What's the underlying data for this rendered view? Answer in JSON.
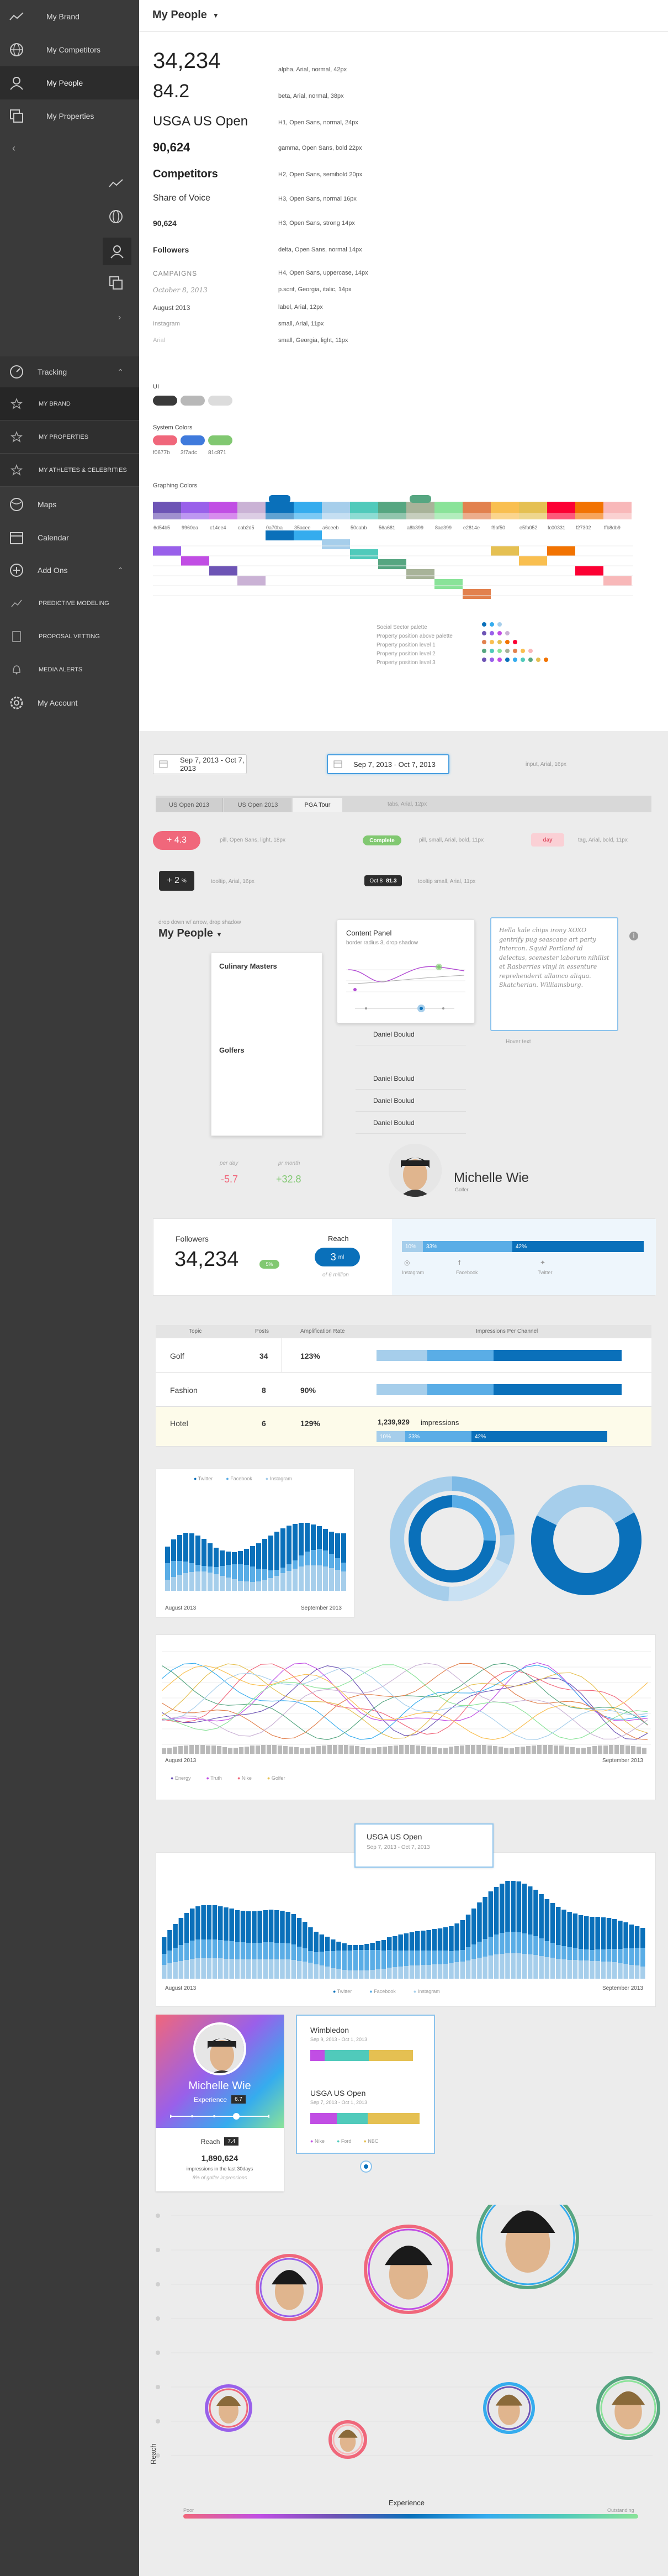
{
  "sidebar": {
    "top_items": [
      {
        "label": "My Brand",
        "icon": "trend-line-icon"
      },
      {
        "label": "My Competitors",
        "icon": "globe-icon"
      },
      {
        "label": "My People",
        "icon": "person-icon"
      },
      {
        "label": "My Properties",
        "icon": "layers-icon"
      }
    ],
    "sections": [
      {
        "label": "Tracking",
        "icon": "gauge-icon"
      },
      {
        "label": "Maps",
        "icon": "map-icon"
      },
      {
        "label": "Calendar",
        "icon": "calendar-icon"
      },
      {
        "label": "Add Ons",
        "icon": "plus-circle-icon"
      }
    ],
    "tracking_items": [
      "MY BRAND",
      "MY PROPERTIES",
      "MY ATHLETES & CELEBRITIES"
    ],
    "addon_items": [
      "PREDICTIVE MODELING",
      "PROPOSAL VETTING",
      "MEDIA ALERTS"
    ],
    "account_label": "My Account"
  },
  "header": {
    "title": "My People"
  },
  "typography": [
    {
      "sample": "34,234",
      "spec": "alpha, Arial, normal, 42px"
    },
    {
      "sample": "84.2",
      "spec": "beta, Arial, normal, 38px"
    },
    {
      "sample": "USGA US Open",
      "spec": "H1, Open Sans, normal, 24px"
    },
    {
      "sample": "90,624",
      "spec": "gamma, Open Sans, bold 22px"
    },
    {
      "sample": "Competitors",
      "spec": "H2, Open Sans, semibold 20px"
    },
    {
      "sample": "Share of Voice",
      "spec": "H3, Open Sans, normal 16px"
    },
    {
      "sample": "90,624",
      "spec": "H3, Open Sans, strong 14px"
    },
    {
      "sample": "Followers",
      "spec": "delta, Open Sans, normal 14px"
    },
    {
      "sample": "CAMPAIGNS",
      "spec": "H4, Open Sans, uppercase, 14px"
    },
    {
      "sample": "October 8, 2013",
      "spec": "p.scrif, Georgia, italic, 14px"
    },
    {
      "sample": "August 2013",
      "spec": "label, Arial, 12px"
    },
    {
      "sample": "Instagram",
      "spec": "small, Arial, 11px"
    },
    {
      "sample": "Arial",
      "spec": "small, Georgia, light, 11px"
    }
  ],
  "ui_label": "UI",
  "ui_colors": [
    "#3a3a3a",
    "#b8b8b8",
    "#dcdcdc"
  ],
  "system_colors_label": "System Colors",
  "system_colors": [
    {
      "hex": "f0677b",
      "color": "#f0677b"
    },
    {
      "hex": "3f7adc",
      "color": "#3f7adc"
    },
    {
      "hex": "81c871",
      "color": "#81c871"
    }
  ],
  "graphing_colors_label": "Graphing Colors",
  "graphing_colors": [
    {
      "hex": "6d54b5",
      "color": "#6d54b5"
    },
    {
      "hex": "9960ea",
      "color": "#9960ea"
    },
    {
      "hex": "c14ee4",
      "color": "#c14ee4"
    },
    {
      "hex": "cab2d5",
      "color": "#cab2d5"
    },
    {
      "hex": "0a70ba",
      "color": "#0a70ba"
    },
    {
      "hex": "35acee",
      "color": "#35acee"
    },
    {
      "hex": "a6ceeb",
      "color": "#a6ceeb"
    },
    {
      "hex": "50cabb",
      "color": "#50cabb"
    },
    {
      "hex": "56a681",
      "color": "#56a681"
    },
    {
      "hex": "a8b399",
      "color": "#a8b399"
    },
    {
      "hex": "8ae399",
      "color": "#8ae399"
    },
    {
      "hex": "e2814e",
      "color": "#e2814e"
    },
    {
      "hex": "f9bf50",
      "color": "#f9bf50"
    },
    {
      "hex": "e5fb052",
      "color": "#e5c052"
    },
    {
      "hex": "fc00331",
      "color": "#fc0033"
    },
    {
      "hex": "f27302",
      "color": "#f27302"
    },
    {
      "hex": "ffb8db9",
      "color": "#f8b8b9"
    }
  ],
  "scale_notes": [
    "Social Sector palette",
    "Property position above palette",
    "Property position level 1",
    "Property position level 2",
    "Property position level 3"
  ],
  "components": {
    "date1": "Sep 7, 2013 - Oct 7, 2013",
    "date2": "Sep 7, 2013 - Oct 7, 2013",
    "date_note": "input, Arial, 16px",
    "tabs": [
      "US Open 2013",
      "US Open 2013",
      "PGA Tour"
    ],
    "tabs_note": "tabs, Arial, 12px",
    "pill_red": "+ 4.3",
    "pill_red_note": "pill, Open Sans, light, 18px",
    "complete": "Complete",
    "complete_note": "pill, small, Arial, bold, 11px",
    "tag": "day",
    "tag_note": "tag, Arial, bold, 11px",
    "tooltip": "+ 2",
    "tooltip_unit": "%",
    "tooltip_note": "tooltip, Arial, 16px",
    "tooltip2": "Oct 8",
    "tooltip2_val": "81.3",
    "tooltip2_note": "tooltip small, Arial, 11px",
    "dropdown_note": "drop down w/ arrow, drop shadow",
    "dropdown_title": "My People",
    "list_header1": "Culinary Masters",
    "list_header2": "Golfers",
    "list_items": [
      "Daniel Boulud",
      "Daniel Boulud",
      "Daniel Boulud",
      "Daniel Boulud",
      "Daniel Boulud",
      "Daniel Boulud"
    ],
    "content_panel_title": "Content Panel",
    "content_panel_sub": "border radius 3, drop shadow",
    "callout_text": "Hella kale chips irony XOXO gentrify pug seascape art party Intercon. Squid Portland id delectus, scenester laborum nihilist et Rasberries vinyl in essenture reprehenderit ullamco aliqua. Skatcherian. Williamsburg.",
    "callout_label": "Hover text",
    "per_day_label": "per day",
    "per_day_val": "-5.7",
    "per_month_label": "pr month",
    "per_month_val": "+32.8",
    "athlete_name": "Michelle Wie",
    "athlete_role": "Golfer"
  },
  "followers_card": {
    "label": "Followers",
    "value": "34,234",
    "badge": "5%",
    "reach_label": "Reach",
    "reach_val": "3",
    "reach_unit": "ml",
    "reach_sub": "of 6 million",
    "channel_pcts": [
      "10%",
      "33%",
      "42%"
    ],
    "channels": [
      "Instagram",
      "Facebook",
      "Twitter"
    ]
  },
  "table": {
    "headers": [
      "Topic",
      "Posts",
      "Amplification Rate",
      "Impressions Per Channel"
    ],
    "rows": [
      {
        "topic": "Golf",
        "posts": "34",
        "rate": "123%"
      },
      {
        "topic": "Fashion",
        "posts": "8",
        "rate": "90%"
      },
      {
        "topic": "Hotel",
        "posts": "6",
        "rate": "129%"
      }
    ],
    "impressions": "1,239,929",
    "impressions_unit": "impressions",
    "seg_labels": [
      "10%",
      "33%",
      "42%"
    ]
  },
  "chart_legend1": [
    "Twitter",
    "Facebook",
    "Instagram"
  ],
  "chart_date_start": "August 2013",
  "chart_date_end": "September 2013",
  "line_legend": [
    "Energy",
    "Truth",
    "Nike",
    "Golfer"
  ],
  "big_chart": {
    "tooltip_title": "USGA US Open",
    "tooltip_date": "Sep 7, 2013 - Oct 7, 2013",
    "legend": [
      "Twitter",
      "Facebook",
      "Instagram"
    ],
    "date_start": "August 2013",
    "date_end": "September 2013"
  },
  "profile_card": {
    "name": "Michelle Wie",
    "experience_label": "Experience",
    "experience_val": "6.7",
    "reach_label": "Reach",
    "reach_val": "7.4",
    "impressions_val": "1,890,624",
    "impressions_label": "impressions in the last 30days",
    "impressions_sub": "8% of golfer impressions"
  },
  "events_card": {
    "event1": "Wimbledon",
    "event1_date": "Sep 9, 2013 - Oct 1, 2013",
    "event2": "USGA US Open",
    "event2_date": "Sep 7, 2013 - Oct 1, 2013",
    "legend": [
      "Nike",
      "Ford",
      "NBC"
    ]
  },
  "scatter": {
    "x_label": "Experience",
    "y_label": "Reach",
    "x_min": "Poor",
    "x_max": "Outstanding"
  }
}
